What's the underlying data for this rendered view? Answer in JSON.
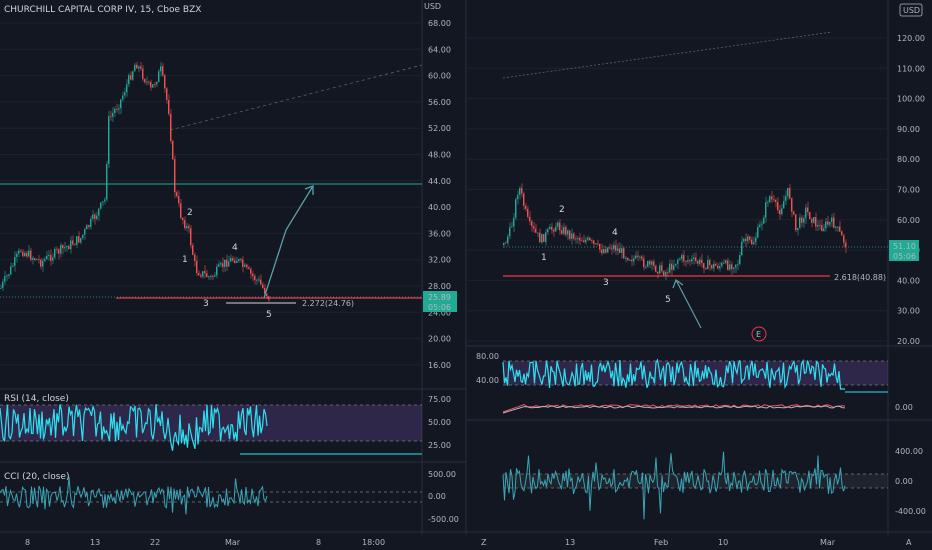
{
  "header": {
    "symbol_title": "CHURCHILL CAPITAL CORP IV, 15, Cboe BZX",
    "currency_left": "USD",
    "currency_right": "USD"
  },
  "left_chart": {
    "price_ticks": [
      "68.00",
      "64.00",
      "60.00",
      "56.00",
      "52.00",
      "48.00",
      "44.00",
      "40.00",
      "36.00",
      "32.00",
      "28.00",
      "24.00",
      "20.00",
      "16.00"
    ],
    "last_price": "25.89",
    "countdown": "05:06",
    "fib_label": "2.272(24.76)",
    "wave_labels": [
      "1",
      "2",
      "3",
      "4",
      "5"
    ],
    "x_ticks": [
      "8",
      "13",
      "22",
      "Mar",
      "8",
      "18:00"
    ],
    "rsi_title": "RSI (14, close)",
    "rsi_ticks": [
      "75.00",
      "50.00",
      "25.00"
    ],
    "cci_title": "CCI (20, close)",
    "cci_ticks": [
      "500.00",
      "0.00",
      "-500.00"
    ]
  },
  "right_chart": {
    "price_ticks": [
      "120.00",
      "110.00",
      "100.00",
      "90.00",
      "80.00",
      "70.00",
      "60.00",
      "50.00",
      "40.00",
      "30.00",
      "20.00"
    ],
    "last_price": "51.10",
    "countdown": "05:06",
    "fib_label": "2.618(40.88)",
    "wave_labels": [
      "1",
      "2",
      "3",
      "4",
      "5"
    ],
    "event_badge": "E",
    "osc1_ticks": [
      "80.00",
      "40.00"
    ],
    "osc2_tick": "0.00",
    "osc3_ticks": [
      "400.00",
      "0.00",
      "-400.00"
    ],
    "x_ticks": [
      "13",
      "Feb",
      "10",
      "Mar"
    ],
    "bottom_left_icon": "Z",
    "bottom_right_icon": "A"
  },
  "colors": {
    "background": "#131722",
    "candle_up": "#26a69a",
    "candle_down": "#ef5350",
    "rsi_line": "#2de0f0",
    "band_fill": "#7e57c2",
    "support_line": "#f23645",
    "target_line": "#22ab94",
    "last_price_bg": "#22ab94"
  }
}
